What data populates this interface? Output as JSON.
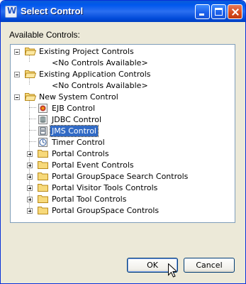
{
  "window": {
    "title": "Select Control"
  },
  "label": "Available Controls:",
  "tree": {
    "existing_project": {
      "label": "Existing Project Controls",
      "child": "<No Controls Available>"
    },
    "existing_application": {
      "label": "Existing Application Controls",
      "child": "<No Controls Available>"
    },
    "new_system": {
      "label": "New System Control",
      "controls": [
        "EJB Control",
        "JDBC Control",
        "JMS Control",
        "Timer Control"
      ],
      "selected": "JMS Control",
      "folders": [
        "Portal Controls",
        "Portal Event Controls",
        "Portal GroupSpace Search Controls",
        "Portal Visitor Tools Controls",
        "Portal Tool Controls",
        "Portal GroupSpace Controls"
      ]
    }
  },
  "buttons": {
    "ok": "OK",
    "cancel": "Cancel"
  },
  "colors": {
    "selection": "#316ac5",
    "titlebar": "#0058ee",
    "face": "#ece9d8"
  }
}
